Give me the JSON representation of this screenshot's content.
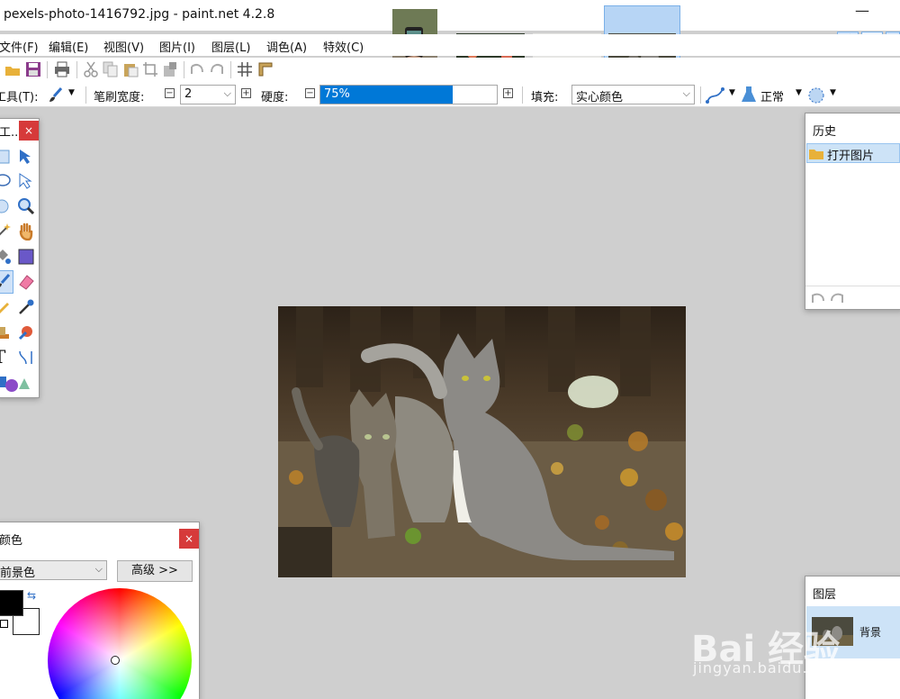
{
  "window": {
    "title": "pexels-photo-1416792.jpg - paint.net 4.2.8",
    "minimize_glyph": "—"
  },
  "menu": [
    "文件(F)",
    "编辑(E)",
    "视图(V)",
    "图片(I)",
    "图层(L)",
    "调色(A)",
    "特效(C)"
  ],
  "thumbnails": [
    {
      "name": "phone-photo",
      "selected": false
    },
    {
      "name": "flowers-photo",
      "selected": false
    },
    {
      "name": "bouquet-photo",
      "selected": false
    },
    {
      "name": "cats-photo",
      "selected": true
    }
  ],
  "toolbar": {
    "tool_label": "工具(T):",
    "brush_width_label": "笔刷宽度:",
    "brush_width_value": "2",
    "hardness_label": "硬度:",
    "hardness_value": "75%",
    "hardness_fraction": 0.75,
    "fill_label": "填充:",
    "fill_value": "实心颜色",
    "blend_mode": "正常"
  },
  "tools_panel": {
    "title": "工...",
    "close": "×"
  },
  "history_panel": {
    "title": "历史",
    "items": [
      "打开图片"
    ]
  },
  "layers_panel": {
    "title": "图层",
    "layers": [
      "背景"
    ]
  },
  "colors_panel": {
    "title": "颜色",
    "close": "×",
    "mode_select": "前景色",
    "advanced_button": "高级 >>",
    "primary_color": "#000000",
    "secondary_color": "#ffffff"
  },
  "watermark": {
    "logo": "Bai 经验",
    "url": "jingyan.baidu.com"
  },
  "colors": {
    "accent": "#0078d7",
    "selection": "#cde3f7",
    "close": "#d63a3a",
    "workspace": "#cfcfcf"
  }
}
